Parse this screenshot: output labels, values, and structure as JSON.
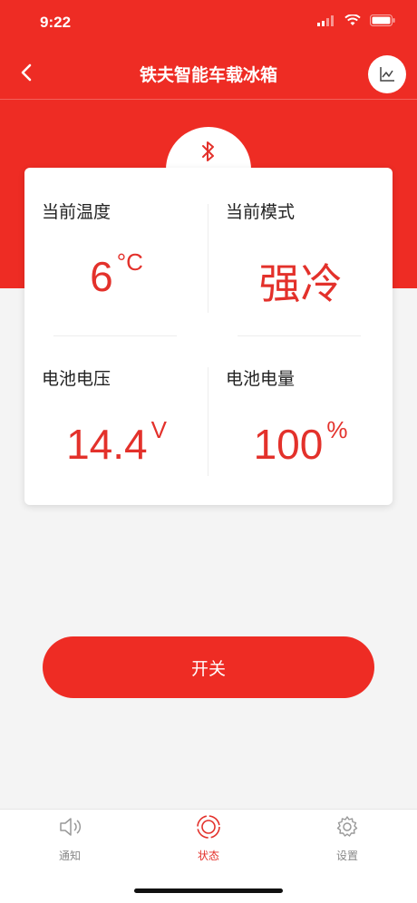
{
  "status_bar": {
    "time": "9:22"
  },
  "header": {
    "title": "铁夫智能车载冰箱"
  },
  "card": {
    "temperature": {
      "label": "当前温度",
      "value": "6",
      "unit": "°C"
    },
    "mode": {
      "label": "当前模式",
      "value": "强冷"
    },
    "voltage": {
      "label": "电池电压",
      "value": "14.4",
      "unit": "V"
    },
    "battery": {
      "label": "电池电量",
      "value": "100",
      "unit": "%"
    }
  },
  "power_button": {
    "label": "开关"
  },
  "tabbar": {
    "items": [
      {
        "label": "通知",
        "icon": "speaker-icon"
      },
      {
        "label": "状态",
        "icon": "status-icon",
        "active": true
      },
      {
        "label": "设置",
        "icon": "gear-icon"
      }
    ]
  },
  "colors": {
    "accent": "#ee2c24",
    "value_text": "#e3312b",
    "background": "#f4f4f4"
  }
}
